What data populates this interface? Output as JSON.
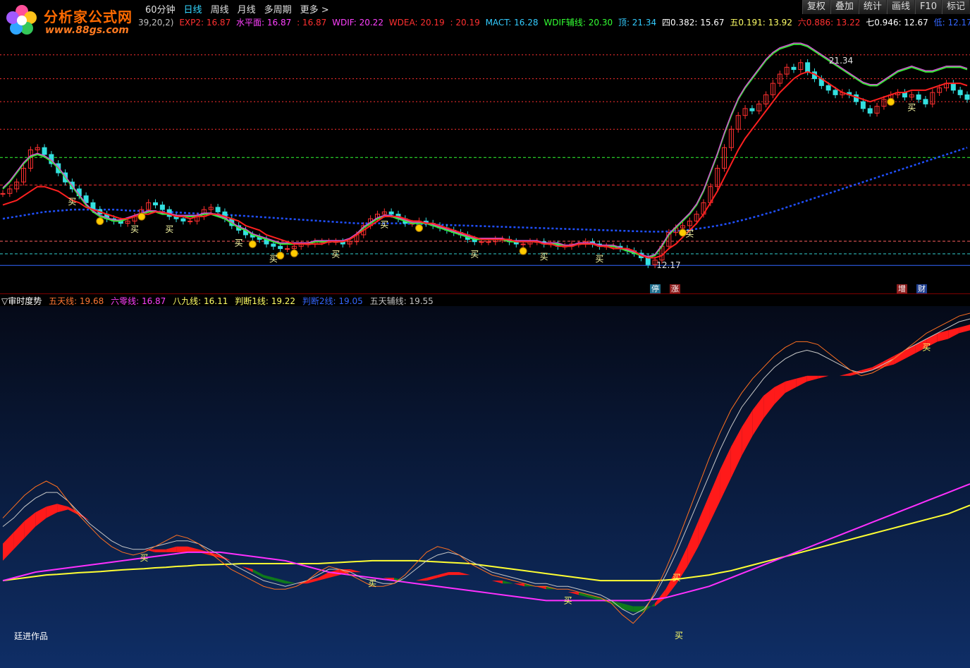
{
  "header": {
    "logo_text": "分析家公式网",
    "logo_url": "www.88gs.com",
    "tabs": [
      {
        "label": "60分钟"
      },
      {
        "label": "日线"
      },
      {
        "label": "周线"
      },
      {
        "label": "月线"
      },
      {
        "label": "多周期"
      },
      {
        "label": "更多 >"
      }
    ],
    "right_tools": [
      "复权",
      "叠加",
      "统计",
      "画线",
      "F10",
      "标记"
    ]
  },
  "main_params": {
    "prefix": "39,20,2)",
    "items": [
      {
        "text": "EXP2: 16.87",
        "color": "#ff3030"
      },
      {
        "text": "水平面: 16.87",
        "color": "#ff40ff"
      },
      {
        "text": ": 16.87",
        "color": "#ff3030"
      },
      {
        "text": "WDIF: 20.22",
        "color": "#ff40ff"
      },
      {
        "text": "WDEA: 20.19",
        "color": "#ff3030"
      },
      {
        "text": ": 20.19",
        "color": "#ff3030"
      },
      {
        "text": "MACT: 16.28",
        "color": "#33ccff"
      },
      {
        "text": "WDIF辅线: 20.30",
        "color": "#33ff33"
      },
      {
        "text": "顶: 21.34",
        "color": "#33ccff"
      },
      {
        "text": "四0.382: 15.67",
        "color": "#ffffff"
      },
      {
        "text": "五0.191: 13.92",
        "color": "#ffff66"
      },
      {
        "text": "六0.886: 13.22",
        "color": "#ff3030"
      },
      {
        "text": "七0.946: 12.67",
        "color": "#ffffff"
      },
      {
        "text": "低: 12.17",
        "color": "#3366ff"
      }
    ]
  },
  "chart_labels": {
    "high_price": "21.34",
    "low_price": "12.17",
    "buy_label": "买",
    "tags": [
      {
        "text": "停",
        "color": "#33ccff"
      },
      {
        "text": "涨",
        "color": "#ff3030"
      },
      {
        "text": "增",
        "color": "#ff3030"
      },
      {
        "text": "财",
        "color": "#33ccff"
      }
    ]
  },
  "indicator": {
    "name": "▽审时度势",
    "items": [
      {
        "text": "五天线: 19.68",
        "color": "#ff7733"
      },
      {
        "text": "六零线: 16.87",
        "color": "#ff40ff"
      },
      {
        "text": "八九线: 16.11",
        "color": "#ffff66"
      },
      {
        "text": "判断1线: 19.22",
        "color": "#ffff66"
      },
      {
        "text": "判断2线: 19.05",
        "color": "#3366ff"
      },
      {
        "text": "五天辅线: 19.55",
        "color": "#c0c0c0"
      }
    ],
    "credit": "廷进作品",
    "buy_label": "买"
  },
  "chart_data": {
    "type": "line",
    "xlim": [
      0,
      140
    ],
    "ylim": [
      11.5,
      22.5
    ],
    "close": [
      15.3,
      15.5,
      15.8,
      16.4,
      17.2,
      17.3,
      17.0,
      16.6,
      16.2,
      15.8,
      15.5,
      15.2,
      14.9,
      14.6,
      14.4,
      14.2,
      14.1,
      14.0,
      14.1,
      14.3,
      14.6,
      14.9,
      14.8,
      14.6,
      14.3,
      14.2,
      14.1,
      14.1,
      14.3,
      14.6,
      14.7,
      14.5,
      14.2,
      13.9,
      13.7,
      13.5,
      13.4,
      13.3,
      13.1,
      13.0,
      12.9,
      12.9,
      13.0,
      13.1,
      13.1,
      13.2,
      13.2,
      13.2,
      13.2,
      13.1,
      13.2,
      13.5,
      13.9,
      14.2,
      14.4,
      14.5,
      14.4,
      14.2,
      14.0,
      14.0,
      14.1,
      14.0,
      13.9,
      13.8,
      13.7,
      13.6,
      13.5,
      13.3,
      13.2,
      13.2,
      13.2,
      13.3,
      13.3,
      13.2,
      13.1,
      13.1,
      13.2,
      13.2,
      13.1,
      13.1,
      13.0,
      13.0,
      13.1,
      13.1,
      13.2,
      13.1,
      13.0,
      13.0,
      13.0,
      12.9,
      12.8,
      12.7,
      12.5,
      12.2,
      12.4,
      13.0,
      13.6,
      13.8,
      13.9,
      14.1,
      14.4,
      14.9,
      15.6,
      16.4,
      17.3,
      18.1,
      18.7,
      19.0,
      18.9,
      19.2,
      19.6,
      20.1,
      20.5,
      20.8,
      20.7,
      21.0,
      20.6,
      20.3,
      20.0,
      19.8,
      19.6,
      19.7,
      19.6,
      19.3,
      19.0,
      18.8,
      19.1,
      19.4,
      19.6,
      19.7,
      19.5,
      19.6,
      19.4,
      19.2,
      19.7,
      19.9,
      20.1,
      19.8,
      19.6,
      19.4
    ],
    "ma_red": [
      14.8,
      14.9,
      15.0,
      15.2,
      15.4,
      15.6,
      15.6,
      15.5,
      15.4,
      15.2,
      15.0,
      14.9,
      14.7,
      14.6,
      14.5,
      14.4,
      14.3,
      14.2,
      14.2,
      14.3,
      14.4,
      14.4,
      14.5,
      14.5,
      14.4,
      14.3,
      14.3,
      14.2,
      14.3,
      14.3,
      14.4,
      14.4,
      14.3,
      14.2,
      14.1,
      13.9,
      13.8,
      13.7,
      13.5,
      13.4,
      13.3,
      13.2,
      13.1,
      13.1,
      13.1,
      13.1,
      13.1,
      13.2,
      13.2,
      13.2,
      13.3,
      13.5,
      13.7,
      13.9,
      14.1,
      14.3,
      14.3,
      14.3,
      14.2,
      14.1,
      14.1,
      14.0,
      14.0,
      13.9,
      13.8,
      13.7,
      13.6,
      13.5,
      13.4,
      13.3,
      13.3,
      13.3,
      13.3,
      13.3,
      13.2,
      13.2,
      13.2,
      13.2,
      13.1,
      13.1,
      13.0,
      13.0,
      13.0,
      13.1,
      13.1,
      13.1,
      13.0,
      13.0,
      12.9,
      12.9,
      12.9,
      12.8,
      12.6,
      12.5,
      12.5,
      12.6,
      12.9,
      13.1,
      13.4,
      13.7,
      14.0,
      14.4,
      14.9,
      15.4,
      16.0,
      16.6,
      17.2,
      17.7,
      18.1,
      18.5,
      18.9,
      19.3,
      19.7,
      20.0,
      20.3,
      20.5,
      20.6,
      20.5,
      20.3,
      20.1,
      19.9,
      19.7,
      19.6,
      19.5,
      19.4,
      19.3,
      19.4,
      19.5,
      19.6,
      19.7,
      19.7,
      19.8,
      19.8,
      19.8,
      19.9,
      20.0,
      20.1,
      20.1,
      20.1,
      20.0
    ],
    "ma_green": [
      15.5,
      15.8,
      16.2,
      16.6,
      16.9,
      17.0,
      16.9,
      16.7,
      16.4,
      16.0,
      15.6,
      15.2,
      14.8,
      14.5,
      14.3,
      14.2,
      14.1,
      14.1,
      14.2,
      14.3,
      14.4,
      14.5,
      14.5,
      14.4,
      14.4,
      14.3,
      14.3,
      14.3,
      14.3,
      14.4,
      14.4,
      14.3,
      14.2,
      14.0,
      13.8,
      13.7,
      13.5,
      13.4,
      13.3,
      13.2,
      13.1,
      13.1,
      13.1,
      13.1,
      13.1,
      13.2,
      13.2,
      13.2,
      13.2,
      13.2,
      13.3,
      13.5,
      13.8,
      14.0,
      14.2,
      14.3,
      14.3,
      14.2,
      14.1,
      14.0,
      14.0,
      14.0,
      13.9,
      13.8,
      13.7,
      13.6,
      13.5,
      13.4,
      13.3,
      13.3,
      13.3,
      13.3,
      13.3,
      13.2,
      13.2,
      13.2,
      13.2,
      13.2,
      13.1,
      13.1,
      13.1,
      13.0,
      13.0,
      13.1,
      13.1,
      13.1,
      13.0,
      13.0,
      13.0,
      12.9,
      12.8,
      12.7,
      12.6,
      12.5,
      12.6,
      13.0,
      13.5,
      13.8,
      14.1,
      14.4,
      14.8,
      15.4,
      16.2,
      17.0,
      17.9,
      18.7,
      19.4,
      19.9,
      20.3,
      20.7,
      21.1,
      21.4,
      21.6,
      21.7,
      21.8,
      21.8,
      21.7,
      21.5,
      21.3,
      21.1,
      20.9,
      20.7,
      20.5,
      20.3,
      20.1,
      20.0,
      20.0,
      20.2,
      20.4,
      20.6,
      20.7,
      20.8,
      20.7,
      20.6,
      20.6,
      20.7,
      20.8,
      20.8,
      20.8,
      20.7
    ],
    "ma_long": [
      14.2,
      14.25,
      14.3,
      14.35,
      14.4,
      14.45,
      14.5,
      14.52,
      14.55,
      14.57,
      14.6,
      14.6,
      14.6,
      14.6,
      14.6,
      14.6,
      14.6,
      14.58,
      14.56,
      14.55,
      14.54,
      14.53,
      14.52,
      14.51,
      14.5,
      14.48,
      14.46,
      14.44,
      14.43,
      14.42,
      14.41,
      14.4,
      14.38,
      14.36,
      14.34,
      14.32,
      14.3,
      14.28,
      14.26,
      14.24,
      14.22,
      14.2,
      14.18,
      14.16,
      14.14,
      14.12,
      14.1,
      14.08,
      14.06,
      14.04,
      14.02,
      14.0,
      14.0,
      14.0,
      14.0,
      14.0,
      14.0,
      14.0,
      13.99,
      13.98,
      13.97,
      13.96,
      13.95,
      13.94,
      13.93,
      13.92,
      13.91,
      13.9,
      13.89,
      13.88,
      13.87,
      13.86,
      13.85,
      13.84,
      13.83,
      13.82,
      13.81,
      13.8,
      13.79,
      13.78,
      13.77,
      13.76,
      13.75,
      13.74,
      13.73,
      13.72,
      13.71,
      13.7,
      13.69,
      13.68,
      13.67,
      13.66,
      13.65,
      13.64,
      13.64,
      13.64,
      13.65,
      13.67,
      13.69,
      13.72,
      13.76,
      13.8,
      13.85,
      13.9,
      13.96,
      14.02,
      14.1,
      14.17,
      14.25,
      14.33,
      14.42,
      14.5,
      14.6,
      14.7,
      14.8,
      14.9,
      15.0,
      15.1,
      15.2,
      15.3,
      15.4,
      15.5,
      15.6,
      15.7,
      15.8,
      15.9,
      16.0,
      16.1,
      16.2,
      16.3,
      16.4,
      16.5,
      16.6,
      16.7,
      16.8,
      16.9,
      17.0,
      17.1,
      17.2,
      17.3
    ],
    "level_lines": [
      {
        "value": 21.34,
        "color": "#ff3030",
        "style": "dot"
      },
      {
        "value": 20.3,
        "color": "#ff3030",
        "style": "dot"
      },
      {
        "value": 19.3,
        "color": "#ff3030",
        "style": "dot"
      },
      {
        "value": 18.1,
        "color": "#ff3030",
        "style": "dot"
      },
      {
        "value": 16.87,
        "color": "#33ff33",
        "style": "dash"
      },
      {
        "value": 15.67,
        "color": "#ff3030",
        "style": "dash"
      },
      {
        "value": 13.22,
        "color": "#ff6060",
        "style": "dash"
      },
      {
        "value": 12.67,
        "color": "#33cccc",
        "style": "dash"
      },
      {
        "value": 12.17,
        "color": "#3366ff",
        "style": "solid"
      }
    ],
    "buy_points_main": [
      10,
      19,
      24,
      34,
      39,
      48,
      55,
      68,
      78,
      86,
      99,
      131
    ],
    "gold_points": [
      14,
      20,
      36,
      40,
      42,
      60,
      75,
      98,
      128
    ],
    "indicator": {
      "ylim": [
        11.5,
        23.5
      ],
      "five_day": [
        16.2,
        16.6,
        17.0,
        17.3,
        17.5,
        17.3,
        16.8,
        16.3,
        15.9,
        15.5,
        15.2,
        15.0,
        14.9,
        15.0,
        15.2,
        15.4,
        15.6,
        15.5,
        15.3,
        15.0,
        14.7,
        14.4,
        14.2,
        14.0,
        13.8,
        13.7,
        13.7,
        13.8,
        14.0,
        14.3,
        14.5,
        14.4,
        14.2,
        14.0,
        13.8,
        13.8,
        13.9,
        14.2,
        14.6,
        15.0,
        15.2,
        15.1,
        14.9,
        14.6,
        14.4,
        14.2,
        14.1,
        14.0,
        13.9,
        13.8,
        13.8,
        13.7,
        13.7,
        13.6,
        13.5,
        13.4,
        13.2,
        12.8,
        12.5,
        12.9,
        13.6,
        14.4,
        15.3,
        16.3,
        17.3,
        18.3,
        19.2,
        20.0,
        20.6,
        21.1,
        21.5,
        21.9,
        22.2,
        22.4,
        22.4,
        22.3,
        22.0,
        21.7,
        21.4,
        21.2,
        21.3,
        21.5,
        21.8,
        22.1,
        22.4,
        22.7,
        22.9,
        23.1,
        23.3,
        23.4
      ],
      "five_aux": [
        15.9,
        16.2,
        16.6,
        16.9,
        17.1,
        17.1,
        16.8,
        16.4,
        16.0,
        15.7,
        15.4,
        15.2,
        15.1,
        15.1,
        15.2,
        15.3,
        15.4,
        15.4,
        15.3,
        15.1,
        14.9,
        14.6,
        14.4,
        14.2,
        14.0,
        13.9,
        13.8,
        13.9,
        14.0,
        14.2,
        14.4,
        14.4,
        14.3,
        14.1,
        14.0,
        13.9,
        13.9,
        14.1,
        14.4,
        14.7,
        14.9,
        15.0,
        14.9,
        14.7,
        14.5,
        14.3,
        14.2,
        14.1,
        14.0,
        13.9,
        13.9,
        13.8,
        13.8,
        13.7,
        13.6,
        13.5,
        13.3,
        13.0,
        12.8,
        13.0,
        13.5,
        14.2,
        15.0,
        15.9,
        16.8,
        17.7,
        18.6,
        19.4,
        20.1,
        20.6,
        21.1,
        21.5,
        21.8,
        22.0,
        22.1,
        22.0,
        21.8,
        21.6,
        21.4,
        21.3,
        21.4,
        21.6,
        21.8,
        22.1,
        22.3,
        22.5,
        22.7,
        22.9,
        23.1,
        23.2
      ],
      "judge1": [
        15.3,
        15.7,
        16.1,
        16.4,
        16.6,
        16.7,
        16.6,
        16.4,
        16.1,
        15.8,
        15.6,
        15.4,
        15.2,
        15.1,
        15.1,
        15.1,
        15.2,
        15.2,
        15.1,
        15.0,
        14.9,
        14.7,
        14.5,
        14.3,
        14.1,
        14.0,
        13.9,
        13.9,
        14.0,
        14.1,
        14.3,
        14.4,
        14.4,
        14.3,
        14.2,
        14.1,
        14.0,
        14.0,
        14.0,
        14.1,
        14.2,
        14.3,
        14.3,
        14.2,
        14.1,
        14.0,
        13.9,
        13.9,
        13.8,
        13.8,
        13.7,
        13.7,
        13.6,
        13.5,
        13.4,
        13.3,
        13.2,
        13.0,
        12.9,
        12.9,
        13.2,
        13.7,
        14.4,
        15.2,
        16.1,
        17.0,
        17.9,
        18.7,
        19.4,
        20.0,
        20.5,
        20.8,
        21.0,
        21.1,
        21.2,
        21.2,
        21.2,
        21.2,
        21.3,
        21.4,
        21.5,
        21.7,
        21.9,
        22.1,
        22.3,
        22.5,
        22.7,
        22.8,
        22.9,
        23.0
      ],
      "judge2": [
        14.7,
        15.1,
        15.5,
        15.9,
        16.2,
        16.4,
        16.5,
        16.3,
        16.1,
        15.8,
        15.6,
        15.4,
        15.2,
        15.1,
        15.0,
        15.0,
        15.0,
        15.0,
        15.0,
        14.9,
        14.8,
        14.7,
        14.5,
        14.4,
        14.2,
        14.1,
        14.0,
        13.9,
        13.9,
        14.0,
        14.1,
        14.2,
        14.3,
        14.3,
        14.2,
        14.1,
        14.1,
        14.0,
        14.0,
        14.0,
        14.1,
        14.2,
        14.2,
        14.2,
        14.1,
        14.0,
        14.0,
        13.9,
        13.9,
        13.8,
        13.8,
        13.7,
        13.6,
        13.6,
        13.5,
        13.4,
        13.3,
        13.2,
        13.1,
        13.1,
        13.1,
        13.4,
        13.9,
        14.5,
        15.2,
        16.0,
        16.8,
        17.6,
        18.4,
        19.1,
        19.7,
        20.2,
        20.6,
        20.8,
        21.0,
        21.1,
        21.2,
        21.2,
        21.2,
        21.3,
        21.4,
        21.5,
        21.6,
        21.8,
        22.0,
        22.2,
        22.4,
        22.5,
        22.7,
        22.8
      ],
      "sixty": [
        14.0,
        14.1,
        14.2,
        14.3,
        14.35,
        14.4,
        14.45,
        14.5,
        14.55,
        14.6,
        14.65,
        14.7,
        14.75,
        14.8,
        14.85,
        14.9,
        14.95,
        15.0,
        15.0,
        15.0,
        15.0,
        14.95,
        14.9,
        14.85,
        14.8,
        14.75,
        14.7,
        14.6,
        14.5,
        14.4,
        14.3,
        14.25,
        14.2,
        14.15,
        14.1,
        14.05,
        14.0,
        13.95,
        13.9,
        13.85,
        13.8,
        13.75,
        13.7,
        13.65,
        13.6,
        13.55,
        13.5,
        13.45,
        13.4,
        13.35,
        13.3,
        13.3,
        13.3,
        13.3,
        13.3,
        13.3,
        13.3,
        13.3,
        13.3,
        13.3,
        13.35,
        13.4,
        13.5,
        13.6,
        13.7,
        13.8,
        13.95,
        14.1,
        14.25,
        14.4,
        14.55,
        14.7,
        14.85,
        15.0,
        15.15,
        15.3,
        15.45,
        15.6,
        15.75,
        15.9,
        16.05,
        16.2,
        16.35,
        16.5,
        16.65,
        16.8,
        16.95,
        17.1,
        17.25,
        17.4
      ],
      "eighty_nine": [
        14.0,
        14.05,
        14.1,
        14.15,
        14.2,
        14.22,
        14.25,
        14.28,
        14.3,
        14.32,
        14.35,
        14.38,
        14.4,
        14.42,
        14.45,
        14.47,
        14.5,
        14.52,
        14.55,
        14.56,
        14.57,
        14.58,
        14.6,
        14.6,
        14.6,
        14.6,
        14.6,
        14.6,
        14.6,
        14.6,
        14.62,
        14.64,
        14.66,
        14.68,
        14.7,
        14.7,
        14.7,
        14.7,
        14.7,
        14.68,
        14.66,
        14.64,
        14.62,
        14.6,
        14.55,
        14.5,
        14.45,
        14.4,
        14.35,
        14.3,
        14.25,
        14.2,
        14.15,
        14.1,
        14.05,
        14.0,
        14.0,
        14.0,
        14.0,
        14.0,
        14.0,
        14.02,
        14.05,
        14.1,
        14.15,
        14.2,
        14.28,
        14.35,
        14.45,
        14.55,
        14.65,
        14.75,
        14.85,
        14.95,
        15.05,
        15.15,
        15.25,
        15.35,
        15.45,
        15.55,
        15.65,
        15.75,
        15.85,
        15.95,
        16.05,
        16.15,
        16.25,
        16.35,
        16.5,
        16.65
      ],
      "buy_points": [
        13,
        34,
        52,
        62,
        85
      ]
    }
  }
}
